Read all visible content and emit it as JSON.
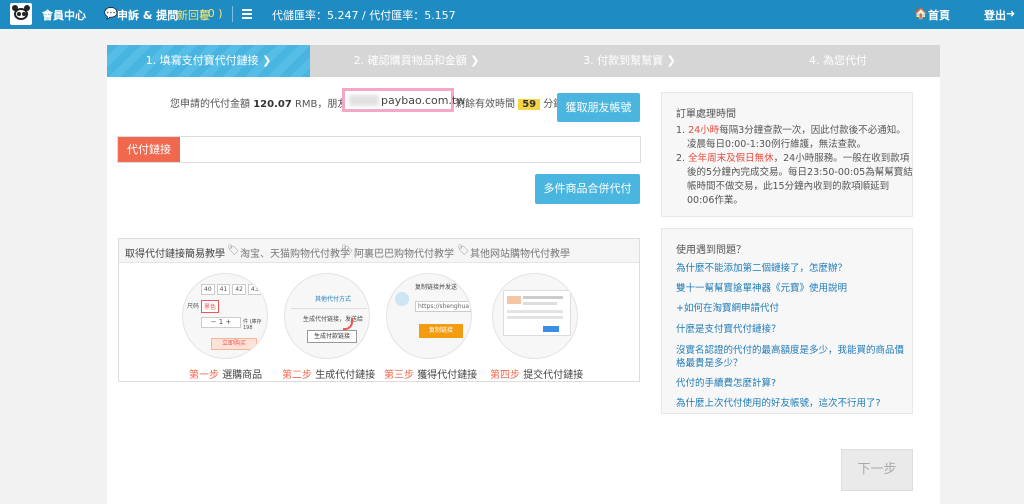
{
  "header": {
    "member_center": "會員中心",
    "complaint": "申訴 & 提問",
    "new_reply": "新回覆",
    "new_reply_count": "( 0 )",
    "rate_text": "代儲匯率：5.247 / 代付匯率：5.157",
    "home": "首頁",
    "logout": "登出"
  },
  "steps": [
    {
      "label": "1. 填寫支付寶代付鏈接 ❯"
    },
    {
      "label": "2. 確認購買物品和金額 ❯"
    },
    {
      "label": "3. 付款到幫幫寶 ❯"
    },
    {
      "label": "4. 為您代付"
    }
  ],
  "request": {
    "prefix": "您申請的代付金額",
    "amount": "120.07",
    "mid": "RMB，朋友帳號",
    "account": "paybao.com.tw",
    "remain": "剩餘有效時間",
    "minutes": "59",
    "unit": "分鐘",
    "get_account_button": "獲取朋友帳號"
  },
  "link": {
    "label": "代付鏈接",
    "value": "",
    "merge_button": "多件商品合併代付"
  },
  "tutorial": {
    "title": "取得代付鏈接簡易教學",
    "tags": [
      "淘宝、天猫购物代付教学",
      "阿裏巴巴购物代付教学",
      "其他网站購物代付教學"
    ],
    "steps": [
      {
        "num": "第一步",
        "text": "選購商品"
      },
      {
        "num": "第二步",
        "text": "生成代付鏈接"
      },
      {
        "num": "第三步",
        "text": "獲得代付鏈接"
      },
      {
        "num": "第四步",
        "text": "提交代付鏈接"
      }
    ],
    "img1": {
      "sizes": [
        "40",
        "41",
        "42",
        "43"
      ],
      "label": "尺码",
      "tag": "黑色",
      "qty": "1",
      "stock": "件 (庫存198",
      "buy": "立即购买"
    },
    "img2": {
      "title": "其他代付方式",
      "hint": "生成代付链接，发送给",
      "btn": "生成付款链接"
    },
    "img3": {
      "title": "复制链接并发送",
      "url": "https://shenghua",
      "btn": "复制链接"
    }
  },
  "order_time": {
    "title": "訂單處理時間",
    "item1_red": "24小時",
    "item1": "每隔3分鐘查款一次，因此付款後不必通知。",
    "item1b": "凌晨每日0:00-1:30例行維護，無法查款。",
    "item2_red": "全年周末及假日無休",
    "item2": "，24小時服務。一般在收到款項",
    "item2b": "後的5分鐘內完成交易。每日23:50-00:05為幫幫寶結",
    "item2c": "帳時間不做交易，此15分鐘內收到的款項順延到",
    "item2d": "00:06作業。"
  },
  "faq": {
    "title": "使用遇到問題？",
    "items": [
      "為什麼不能添加第二個鏈接了，怎麼辦？",
      "雙十一幫幫寶搶單神器《元寶》使用說明",
      "+如何在淘寶網申請代付",
      "什麼是支付寶代付鏈接？",
      "沒實名認證的代付的最高額度是多少，我能買的商品價",
      "格最貴是多少？",
      "代付的手續費怎麼計算?",
      "為什麼上次代付使用的好友帳號，這次不行用了?"
    ]
  },
  "next_button": "下一步",
  "colors": {
    "primary": "#1e8bc3",
    "accent": "#4ab6e0",
    "red": "#f0684e",
    "highlight": "#f5d445"
  }
}
